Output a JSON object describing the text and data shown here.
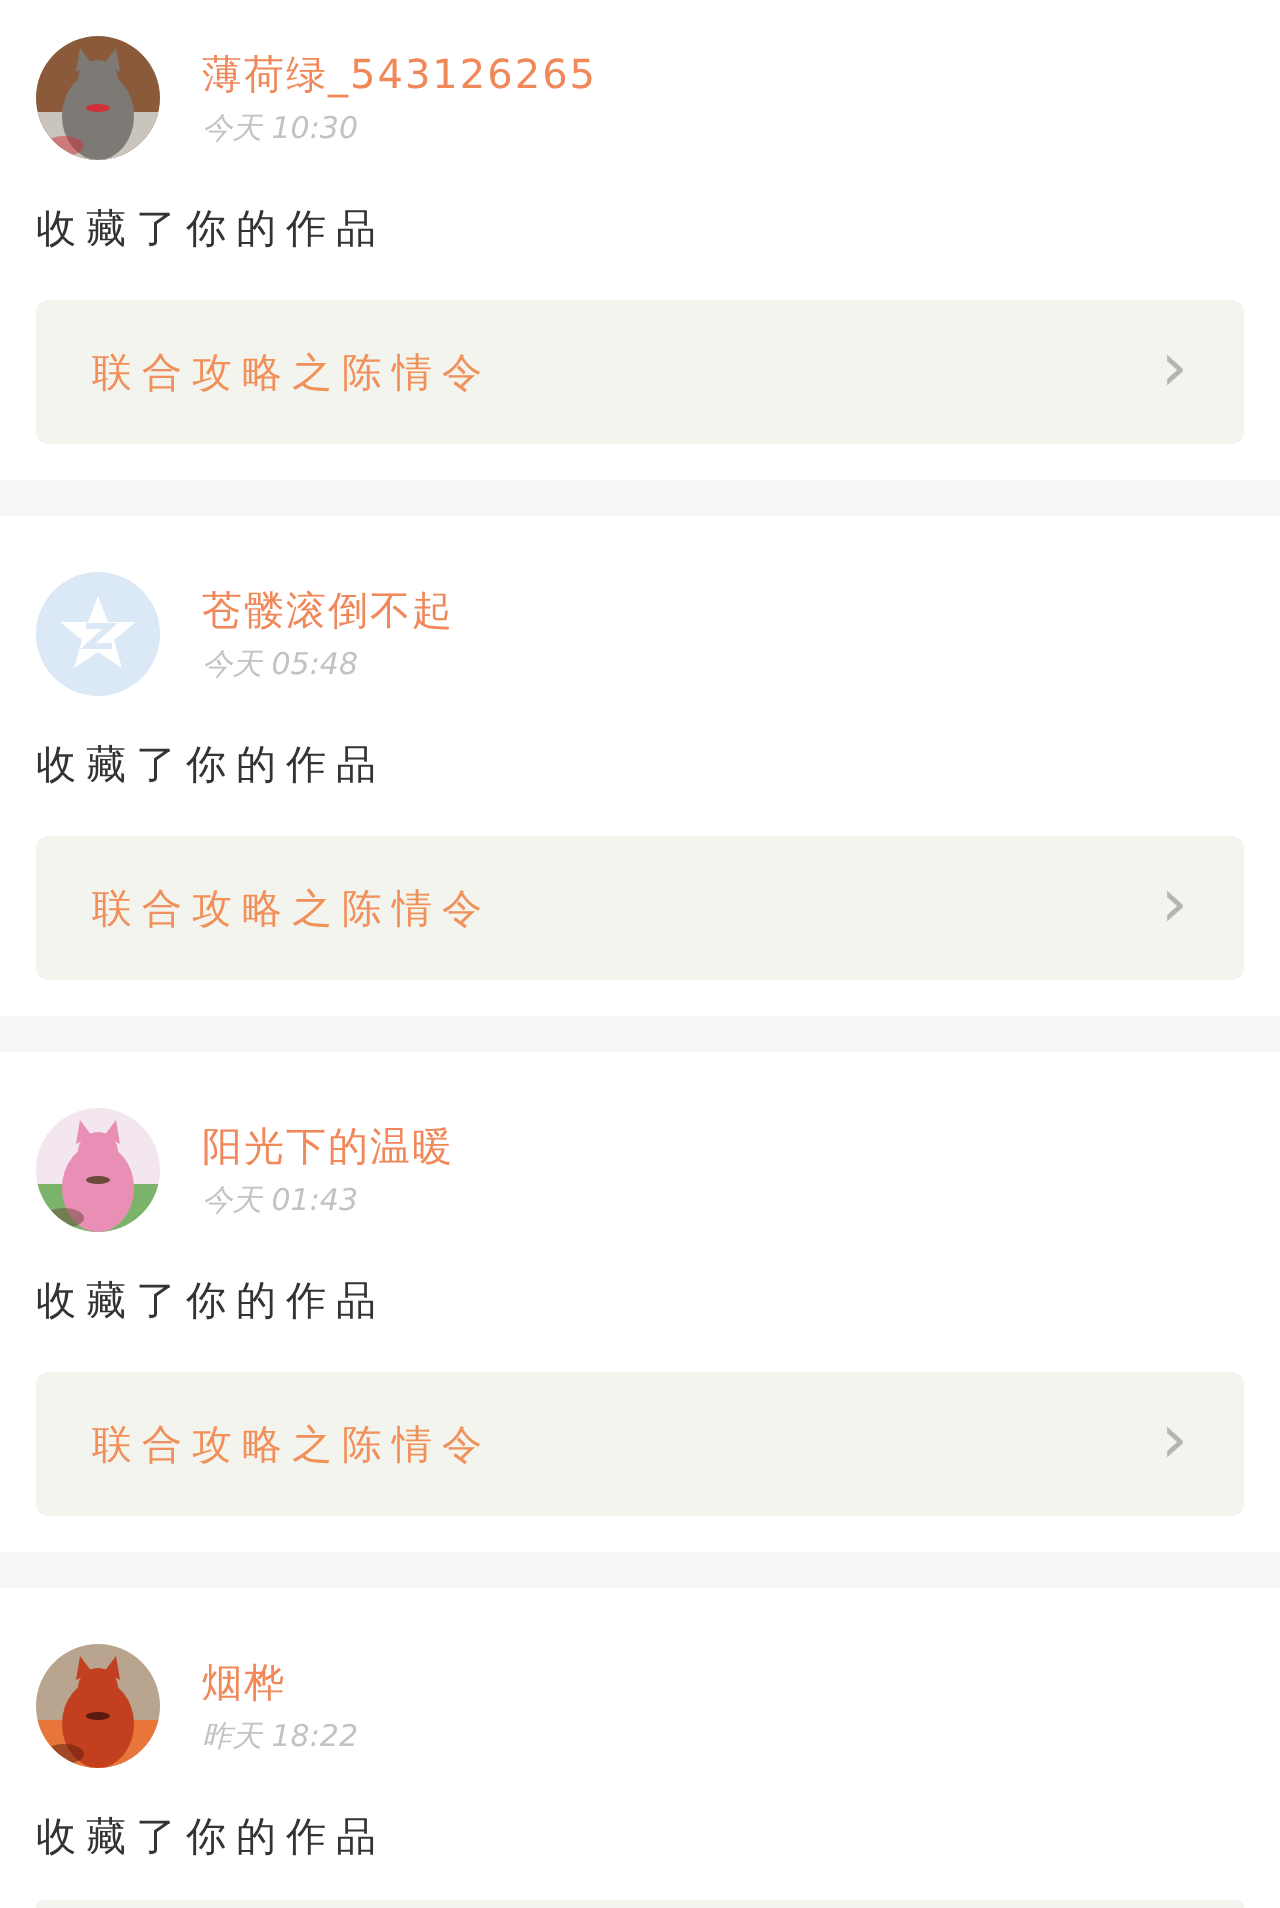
{
  "notifications": [
    {
      "name": "薄荷绿_543126265",
      "time": "今天 10:30",
      "action": "收藏了你的作品",
      "card": {
        "title": "联合攻略之陈情令",
        "arrow": "›"
      }
    },
    {
      "avatar": {
        "kind": "default"
      },
      "name": "苍髅滚倒不起",
      "time": "今天 05:48",
      "action": "收藏了你的作品",
      "card": {
        "title": "联合攻略之陈情令",
        "arrow": "›"
      }
    },
    {
      "name": "阳光下的温暖",
      "time": "今天 01:43",
      "action": "收藏了你的作品",
      "card": {
        "title": "联合攻略之陈情令",
        "arrow": "›"
      }
    },
    {
      "name": "烟桦",
      "time": "昨天 18:22",
      "action": "收藏了你的作品",
      "card": {
        "cut_off": true
      }
    }
  ]
}
